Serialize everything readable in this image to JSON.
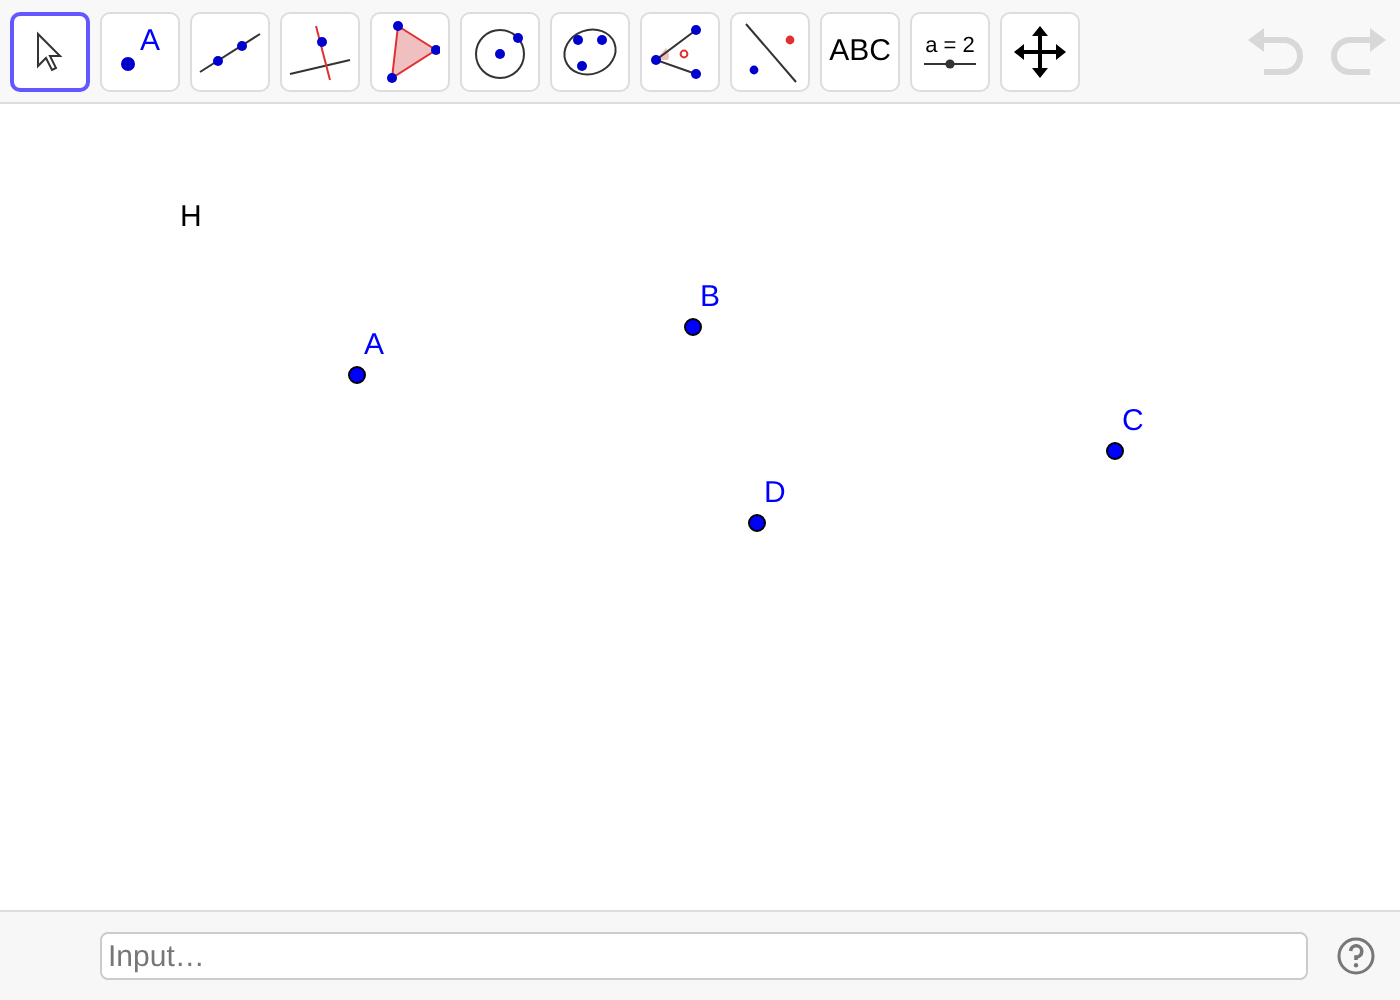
{
  "toolbar": {
    "tools": [
      {
        "kind": "move",
        "selected": true
      },
      {
        "kind": "point",
        "label": "A",
        "selected": false
      },
      {
        "kind": "line",
        "selected": false
      },
      {
        "kind": "perpendicular",
        "selected": false
      },
      {
        "kind": "polygon",
        "selected": false
      },
      {
        "kind": "circle",
        "selected": false
      },
      {
        "kind": "conic",
        "selected": false
      },
      {
        "kind": "angle",
        "selected": false
      },
      {
        "kind": "reflect",
        "selected": false
      },
      {
        "kind": "text",
        "label": "ABC",
        "selected": false
      },
      {
        "kind": "slider",
        "label": "a = 2",
        "selected": false
      },
      {
        "kind": "move-view",
        "selected": false
      }
    ],
    "undo": {
      "disabled": true
    },
    "redo": {
      "disabled": true
    }
  },
  "canvas": {
    "texts": [
      {
        "text": "H"
      }
    ],
    "points": [
      {
        "label": "A"
      },
      {
        "label": "B"
      },
      {
        "label": "C"
      },
      {
        "label": "D"
      }
    ]
  },
  "input_bar": {
    "placeholder": "Input…"
  }
}
